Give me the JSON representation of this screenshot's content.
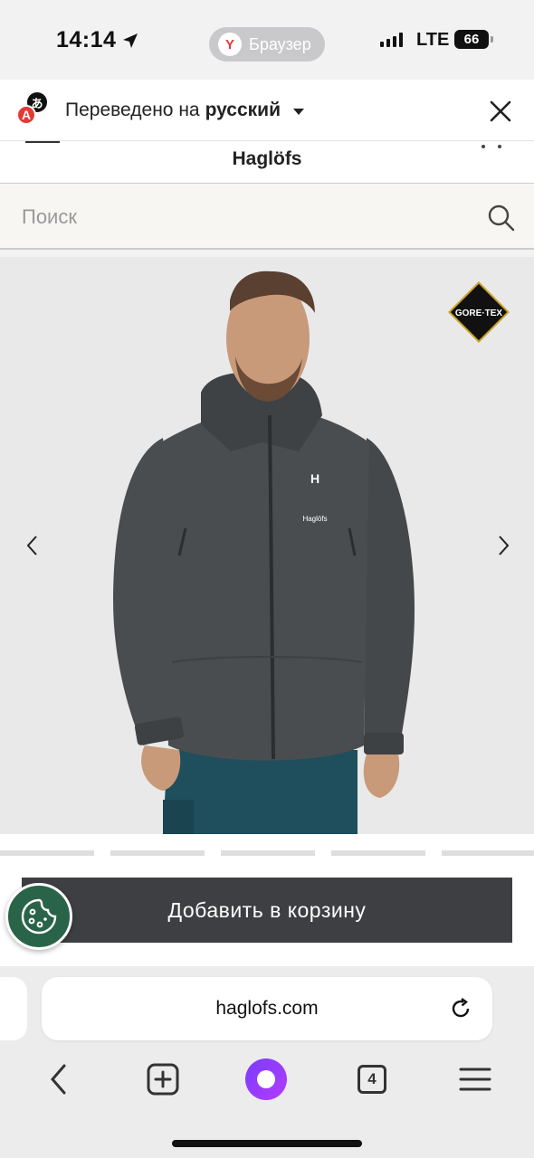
{
  "status_bar": {
    "time": "14:14",
    "browser_label": "Браузер",
    "network": "LTE",
    "battery": "66"
  },
  "translate_bar": {
    "prefix": "Переведено на",
    "language": "русский"
  },
  "site": {
    "brand": "Haglöfs",
    "search_placeholder": "Поиск"
  },
  "product": {
    "chest_logo": "Haglöfs",
    "badge": "GORE-TEX",
    "add_to_cart": "Добавить в корзину"
  },
  "browser": {
    "url": "haglofs.com",
    "tabs_count": "4"
  },
  "colors": {
    "cart_button": "#3d3f42",
    "cookie_button": "#2a6448",
    "jacket": "#4a4d50",
    "pants": "#1f4f5c",
    "alice_accent": "#8a3cff"
  }
}
